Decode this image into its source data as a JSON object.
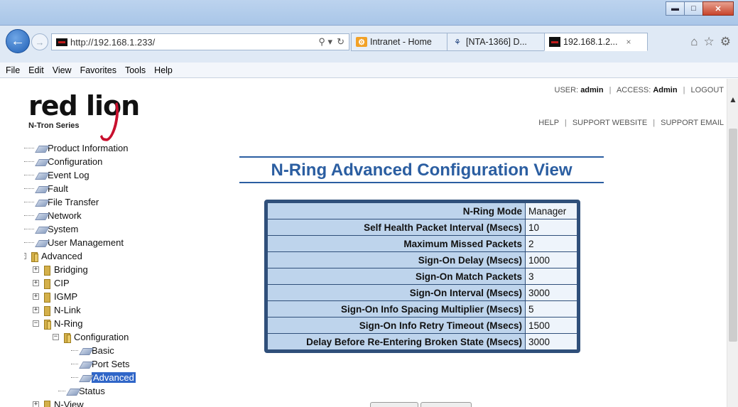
{
  "browser": {
    "address": "http://192.168.1.233/",
    "tabs": [
      {
        "label": "Intranet - Home",
        "icon": "intranet-tab-icon"
      },
      {
        "label": "[NTA-1366] D...",
        "icon": "jira-tab-icon"
      },
      {
        "label": "192.168.1.2...",
        "icon": "redlion-tab-icon"
      }
    ],
    "tab_close": "×",
    "menu": [
      "File",
      "Edit",
      "View",
      "Favorites",
      "Tools",
      "Help"
    ]
  },
  "header": {
    "logo_text": "red lion",
    "logo_sub": "N-Tron Series",
    "user_label": "USER:",
    "user": "admin",
    "access_label": "ACCESS:",
    "access": "Admin",
    "logout": "LOGOUT",
    "help": "HELP",
    "support_website": "SUPPORT WEBSITE",
    "support_email": "SUPPORT EMAIL"
  },
  "tree": {
    "items": [
      {
        "label": "Product Information"
      },
      {
        "label": "Configuration"
      },
      {
        "label": "Event Log"
      },
      {
        "label": "Fault"
      },
      {
        "label": "File Transfer"
      },
      {
        "label": "Network"
      },
      {
        "label": "System"
      },
      {
        "label": "User Management"
      },
      {
        "label": "Advanced"
      },
      {
        "label": "Bridging"
      },
      {
        "label": "CIP"
      },
      {
        "label": "IGMP"
      },
      {
        "label": "N-Link"
      },
      {
        "label": "N-Ring"
      },
      {
        "label": "Configuration"
      },
      {
        "label": "Basic"
      },
      {
        "label": "Port Sets"
      },
      {
        "label": "Advanced"
      },
      {
        "label": "Status"
      },
      {
        "label": "N-View"
      }
    ]
  },
  "main": {
    "title": "N-Ring Advanced Configuration View",
    "rows": [
      {
        "label": "N-Ring Mode",
        "value": "Manager"
      },
      {
        "label": "Self Health Packet Interval (Msecs)",
        "value": "10"
      },
      {
        "label": "Maximum Missed Packets",
        "value": "2"
      },
      {
        "label": "Sign-On Delay (Msecs)",
        "value": "1000"
      },
      {
        "label": "Sign-On Match Packets",
        "value": "3"
      },
      {
        "label": "Sign-On Interval (Msecs)",
        "value": "3000"
      },
      {
        "label": "Sign-On Info Spacing Multiplier (Msecs)",
        "value": "5"
      },
      {
        "label": "Sign-On Info Retry Timeout (Msecs)",
        "value": "1500"
      },
      {
        "label": "Delay Before Re-Entering Broken State (Msecs)",
        "value": "3000"
      }
    ]
  },
  "colors": {
    "heading": "#2b5ea1",
    "table_border": "#2f4f7a",
    "label_bg": "#bed4ec",
    "selected": "#3066c8",
    "brand_red": "#c8102e"
  }
}
